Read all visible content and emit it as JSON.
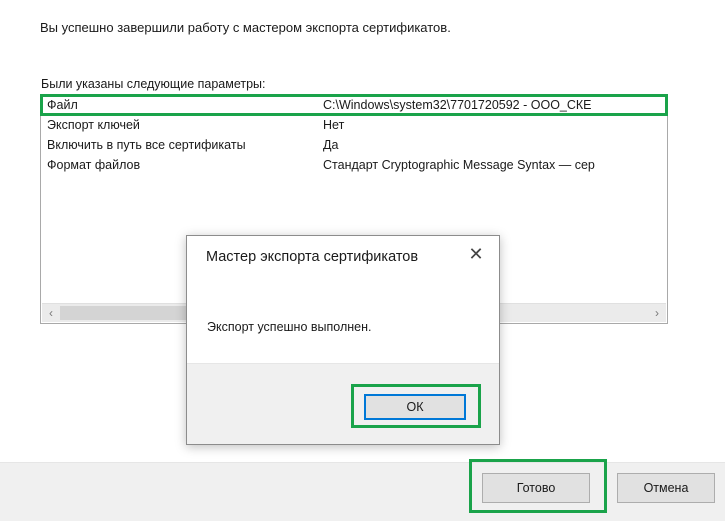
{
  "wizard": {
    "intro": "Вы успешно завершили работу с мастером экспорта сертификатов.",
    "params_label": "Были указаны следующие параметры:",
    "params": [
      {
        "key": "Файл",
        "value": "C:\\Windows\\system32\\7701720592 - ООО_СКЕ"
      },
      {
        "key": "Экспорт ключей",
        "value": "Нет"
      },
      {
        "key": "Включить в путь все сертификаты",
        "value": "Да"
      },
      {
        "key": "Формат файлов",
        "value": "Стандарт Cryptographic Message Syntax — сер"
      }
    ],
    "scroll_left": "‹",
    "scroll_right": "›",
    "finish_label": "Готово",
    "cancel_label": "Отмена"
  },
  "dialog": {
    "title": "Мастер экспорта сертификатов",
    "close_glyph": "✕",
    "message": "Экспорт успешно выполнен.",
    "ok_label": "ОК"
  },
  "colors": {
    "highlight": "#1aa34a",
    "focus": "#0078d7"
  },
  "icons": {
    "close": "close-icon",
    "scroll_left": "chevron-left-icon",
    "scroll_right": "chevron-right-icon"
  }
}
